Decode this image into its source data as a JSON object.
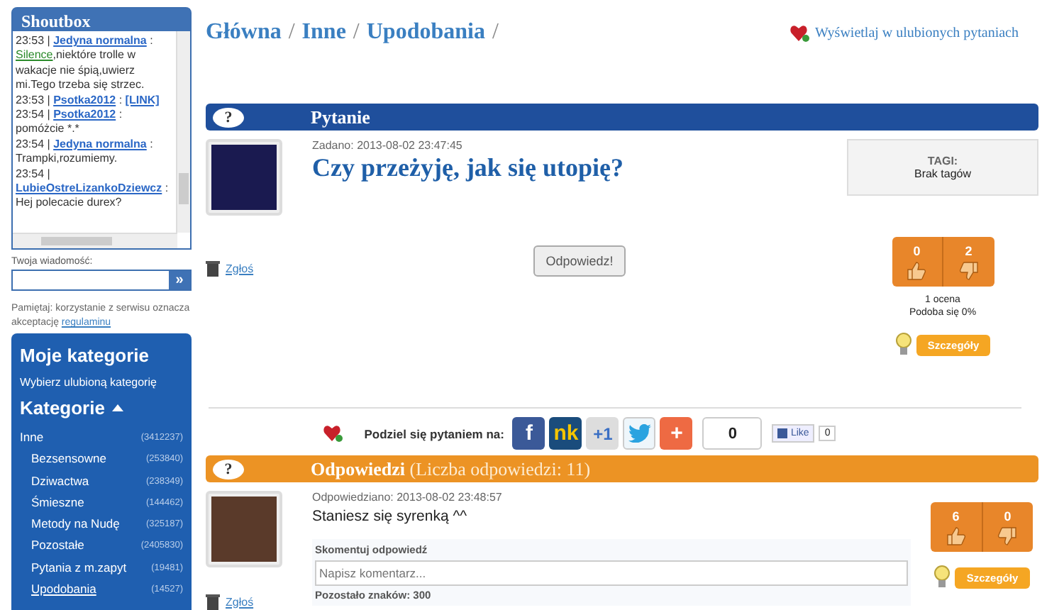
{
  "shoutbox": {
    "title": "Shoutbox",
    "messages": [
      {
        "time": "23:53 |",
        "user": "Jedyna normalna",
        "sep": ":",
        "target": "Silence",
        "text": ",niektóre trolle w wakacje nie śpią,uwierz mi.Tego trzeba się strzec."
      },
      {
        "time": "23:53 |",
        "user": "Psotka2012",
        "sep": ":",
        "link": "[LINK]"
      },
      {
        "time": "23:54 |",
        "user": "Psotka2012",
        "sep": ":",
        "text": "pomóżcie *.*"
      },
      {
        "time": "23:54 |",
        "user": "Jedyna normalna",
        "sep": ":",
        "text": "Trampki,rozumiemy."
      },
      {
        "time": "23:54 |",
        "user": "LubieOstreLizankoDziewcz",
        "text": ": Hej polecacie durex?"
      }
    ],
    "input_label": "Twoja wiadomość:",
    "send": "»",
    "notice": "Pamiętaj: korzystanie z serwisu oznacza akceptację",
    "notice_link": "regulaminu"
  },
  "categories_panel": {
    "my_title": "Moje kategorie",
    "my_hint": "Wybierz ulubioną kategorię",
    "title": "Kategorie",
    "expanded": true,
    "root": {
      "name": "Inne",
      "count": "(3412237)",
      "selected": false,
      "children": [
        {
          "name": "Bezsensowne",
          "count": "(253840)",
          "selected": false
        },
        {
          "name": "Dziwactwa",
          "count": "(238349)",
          "selected": false
        },
        {
          "name": "Śmieszne",
          "count": "(144462)",
          "selected": false
        },
        {
          "name": "Metody na Nudę",
          "count": "(325187)",
          "selected": false
        },
        {
          "name": "Pozostałe",
          "count": "(2405830)",
          "selected": false
        },
        {
          "name": "Pytania z m.zapyt",
          "count": "(19481)",
          "selected": false
        },
        {
          "name": "Upodobania",
          "count": "(14527)",
          "selected": true
        }
      ]
    }
  },
  "breadcrumb": {
    "items": [
      "Główna",
      "Inne",
      "Upodobania"
    ],
    "separator": "/"
  },
  "favorite_link": "Wyświetlaj w ulubionych pytaniach",
  "question": {
    "icon": "?",
    "header": "Pytanie",
    "asked": "Zadano: 2013-08-02 23:47:45",
    "title": "Czy przeżyję, jak się utopię?",
    "tags_label": "TAGI:",
    "tags_value": "Brak tagów",
    "report": "Zgłoś",
    "answer_button": "Odpowiedz!",
    "likes": "0",
    "dislikes": "2",
    "rating_count": "1 ocena",
    "rating_percent": "Podoba się 0%",
    "details": "Szczegóły"
  },
  "share": {
    "label": "Podziel się pytaniem na:",
    "buttons": [
      {
        "kind": "facebook",
        "text": "f"
      },
      {
        "kind": "nk",
        "text": "nk"
      },
      {
        "kind": "plusone",
        "text": "+1"
      },
      {
        "kind": "twitter"
      },
      {
        "kind": "more",
        "text": "+"
      }
    ],
    "count": "0",
    "like": "Like",
    "like_count": "0"
  },
  "answers": {
    "icon": "?",
    "header": "Odpowiedzi",
    "count_text": "(Liczba odpowiedzi: 11)",
    "items": [
      {
        "answered": "Odpowiedziano: 2013-08-02 23:48:57",
        "text": "Staniesz się syrenką ^^",
        "comment_label": "Skomentuj odpowiedź",
        "comment_placeholder": "Napisz komentarz...",
        "remaining": "Pozostało znaków: 300",
        "likes": "6",
        "dislikes": "0",
        "details": "Szczegóły",
        "report": "Zgłoś"
      }
    ]
  }
}
